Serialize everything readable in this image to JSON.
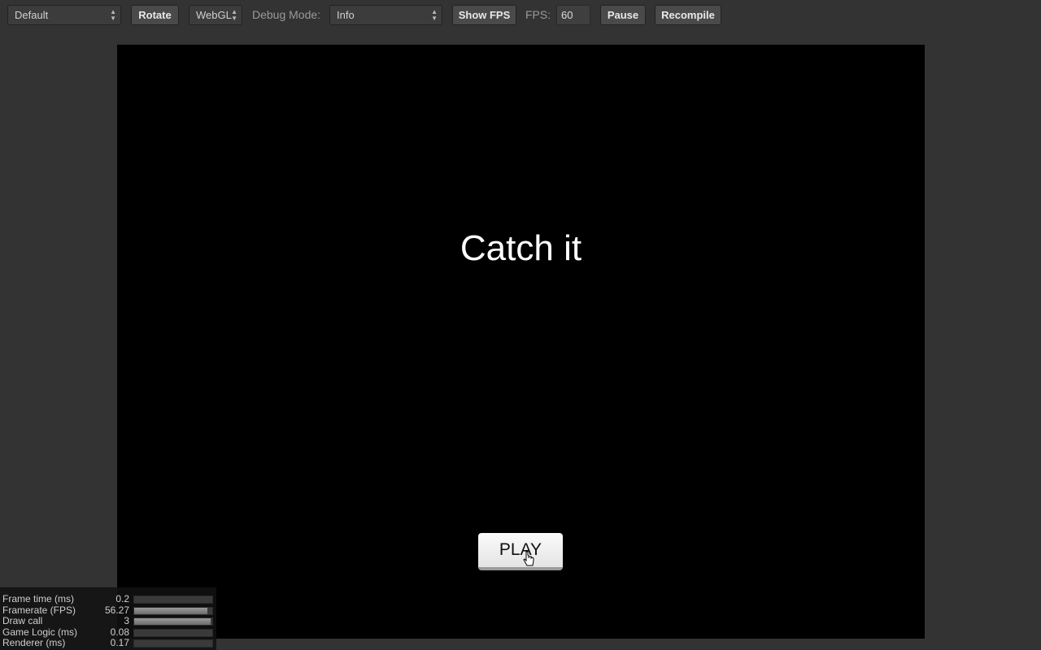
{
  "toolbar": {
    "resolution_select": "Default",
    "rotate_label": "Rotate",
    "renderer_select": "WebGL",
    "debug_label": "Debug Mode:",
    "debug_select": "Info",
    "show_fps_label": "Show FPS",
    "fps_label": "FPS:",
    "fps_value": "60",
    "pause_label": "Pause",
    "recompile_label": "Recompile"
  },
  "game": {
    "title": "Catch it",
    "play_label": "PLAY"
  },
  "stats": [
    {
      "name": "Frame time (ms)",
      "value": "0.2",
      "fill": 0.0
    },
    {
      "name": "Framerate (FPS)",
      "value": "56.27",
      "fill": 0.94
    },
    {
      "name": "Draw call",
      "value": "3",
      "fill": 0.98
    },
    {
      "name": "Game Logic (ms)",
      "value": "0.08",
      "fill": 0.0
    },
    {
      "name": "Renderer (ms)",
      "value": "0.17",
      "fill": 0.0
    }
  ],
  "icons": {
    "select_arrow": "up-down-arrow-icon",
    "cursor": "pointer-hand-icon"
  }
}
